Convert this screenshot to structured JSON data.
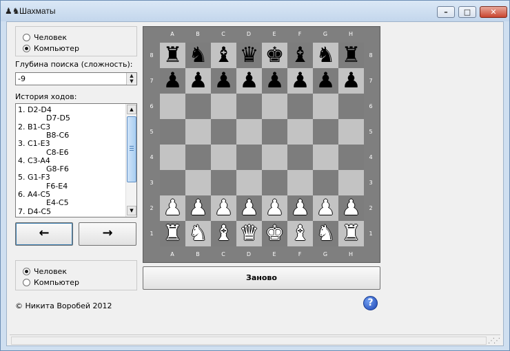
{
  "window": {
    "title": "Шахматы",
    "app_icon": "chess-icon",
    "buttons": {
      "minimize": "—",
      "maximize": "▢",
      "close": "✕"
    }
  },
  "top_player": {
    "options": [
      "Человек",
      "Компьютер"
    ],
    "selected": "Компьютер"
  },
  "depth": {
    "label": "Глубина поиска (сложность):",
    "value": "-9"
  },
  "history": {
    "label": "История ходов:",
    "lines": [
      {
        "text": "1. D2-D4",
        "indent": false
      },
      {
        "text": "D7-D5",
        "indent": true
      },
      {
        "text": "2. B1-C3",
        "indent": false
      },
      {
        "text": "B8-C6",
        "indent": true
      },
      {
        "text": "3. C1-E3",
        "indent": false
      },
      {
        "text": "C8-E6",
        "indent": true
      },
      {
        "text": "4. C3-A4",
        "indent": false
      },
      {
        "text": "G8-F6",
        "indent": true
      },
      {
        "text": "5. G1-F3",
        "indent": false
      },
      {
        "text": "F6-E4",
        "indent": true
      },
      {
        "text": "6. A4-C5",
        "indent": false
      },
      {
        "text": "E4-C5",
        "indent": true
      },
      {
        "text": "7. D4-C5",
        "indent": false
      }
    ]
  },
  "nav": {
    "back": "🡐",
    "forward": "🡒",
    "back_glyph": "←",
    "forward_glyph": "→"
  },
  "bottom_player": {
    "options": [
      "Человек",
      "Компьютер"
    ],
    "selected": "Человек"
  },
  "copyright": "© Никита Воробей 2012",
  "restart_label": "Заново",
  "help_label": "?",
  "board": {
    "files": [
      "A",
      "B",
      "C",
      "D",
      "E",
      "F",
      "G",
      "H"
    ],
    "ranks": [
      "8",
      "7",
      "6",
      "5",
      "4",
      "3",
      "2",
      "1"
    ],
    "rows": [
      [
        "br",
        "bn",
        "bb",
        "bq",
        "bk",
        "bb",
        "bn",
        "br"
      ],
      [
        "bp",
        "bp",
        "bp",
        "bp",
        "bp",
        "bp",
        "bp",
        "bp"
      ],
      [
        "",
        "",
        "",
        "",
        "",
        "",
        "",
        ""
      ],
      [
        "",
        "",
        "",
        "",
        "",
        "",
        "",
        ""
      ],
      [
        "",
        "",
        "",
        "",
        "",
        "",
        "",
        ""
      ],
      [
        "",
        "",
        "",
        "",
        "",
        "",
        "",
        ""
      ],
      [
        "wp",
        "wp",
        "wp",
        "wp",
        "wp",
        "wp",
        "wp",
        "wp"
      ],
      [
        "wr",
        "wn",
        "wb",
        "wq",
        "wk",
        "wb",
        "wn",
        "wr"
      ]
    ],
    "colors": {
      "light": "#c3c3c3",
      "dark": "#7d7d7d",
      "frame": "#7f7f7f"
    }
  }
}
